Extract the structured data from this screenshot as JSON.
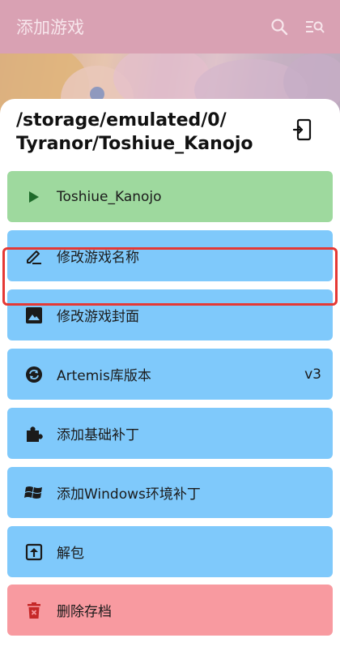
{
  "appbar": {
    "title": "添加游戏",
    "search_icon": "search-icon",
    "filter_icon": "search-list-icon"
  },
  "sheet": {
    "path": "/storage/emulated/0/\nTyranor/Toshiue_Kanojo",
    "open_icon": "open-in-new-icon",
    "items": [
      {
        "label": "Toshiue_Kanojo",
        "icon": "play-icon"
      },
      {
        "label": "修改游戏名称",
        "icon": "edit-icon"
      },
      {
        "label": "修改游戏封面",
        "icon": "image-icon"
      },
      {
        "label": "Artemis库版本",
        "icon": "sync-icon",
        "value": "v3"
      },
      {
        "label": "添加基础补丁",
        "icon": "puzzle-icon"
      },
      {
        "label": "添加Windows环境补丁",
        "icon": "windows-icon"
      },
      {
        "label": "解包",
        "icon": "unpack-icon"
      },
      {
        "label": "删除存档",
        "icon": "delete-icon"
      }
    ]
  },
  "colors": {
    "appbar": "#d9a1b3",
    "play": "#9ed99e",
    "action": "#7fc9fb",
    "danger": "#f89aa0",
    "highlight": "#e53935"
  }
}
